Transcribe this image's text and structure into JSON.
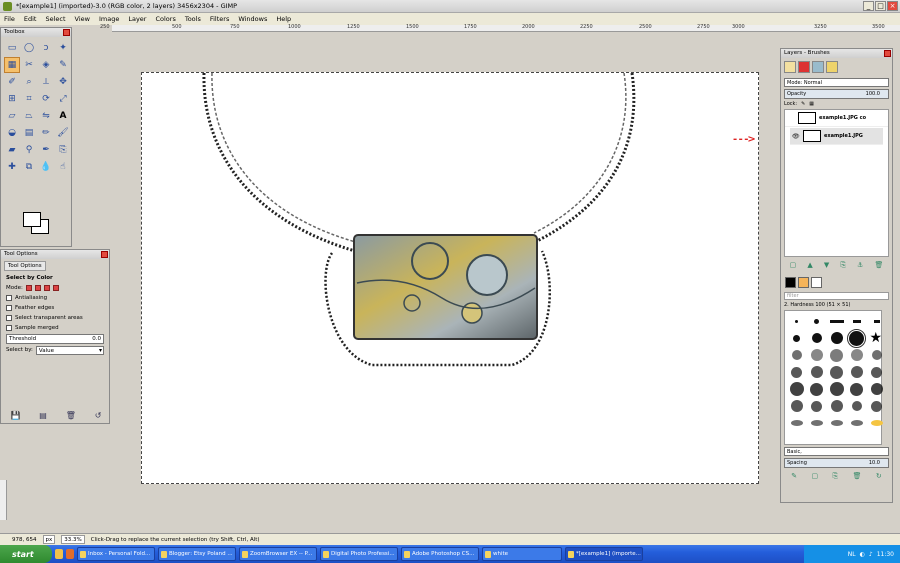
{
  "window": {
    "title": "*[example1] (imported)-3.0 (RGB color, 2 layers) 3456x2304 - GIMP",
    "controls": [
      "_",
      "□",
      "×"
    ]
  },
  "menu": [
    "File",
    "Edit",
    "Select",
    "View",
    "Image",
    "Layer",
    "Colors",
    "Tools",
    "Filters",
    "Windows",
    "Help"
  ],
  "ruler": [
    "250",
    "500",
    "750",
    "1000",
    "1250",
    "1500",
    "1750",
    "2000",
    "2250",
    "2500",
    "2750",
    "3000",
    "3250",
    "3500"
  ],
  "toolbox": {
    "title": "Toolbox",
    "tools": [
      "rect-select",
      "ellipse-select",
      "free-select",
      "fuzzy-select",
      "select-by-color",
      "scissors",
      "foreground-select",
      "paths",
      "color-picker",
      "zoom",
      "measure",
      "move",
      "align",
      "crop",
      "rotate",
      "scale",
      "shear",
      "perspective",
      "flip",
      "text",
      "bucket-fill",
      "blend",
      "pencil",
      "paintbrush",
      "eraser",
      "airbrush",
      "ink",
      "clone",
      "heal",
      "perspective-clone",
      "blur",
      "smudge",
      "dodge-burn"
    ]
  },
  "tool_options": {
    "title": "Tool Options",
    "tab": "Tool Options",
    "heading": "Select by Color",
    "mode_label": "Mode:",
    "antialiasing": "Antialiasing",
    "feather": "Feather edges",
    "transparent": "Select transparent areas",
    "merged": "Sample merged",
    "threshold_label": "Threshold",
    "threshold_value": "0.0",
    "select_by_label": "Select by:",
    "select_by_value": "Value"
  },
  "layers": {
    "title": "Layers - Brushes",
    "mode_label": "Mode:",
    "mode_value": "Normal",
    "opacity_label": "Opacity",
    "opacity_value": "100.0",
    "lock_label": "Lock:",
    "items": [
      {
        "name": "example1.JPG co"
      },
      {
        "name": "example1.JPG"
      }
    ]
  },
  "brushes": {
    "filter_placeholder": "filter",
    "current": "2. Hardness 100 (51 × 51)",
    "preset": "Basic,",
    "spacing_label": "Spacing",
    "spacing_value": "10.0"
  },
  "status": {
    "coords": "978, 654",
    "unit": "px",
    "zoom": "33.3%",
    "message": "Click-Drag to replace the current selection (try Shift, Ctrl, Alt)"
  },
  "taskbar": {
    "start": "start",
    "tasks": [
      "Inbox - Personal Fold...",
      "Blogger: Etsy Poland ...",
      "ZoomBrowser EX -- P...",
      "Digital Photo Professi...",
      "Adobe Photoshop CS...",
      "white",
      "*[example1] (importe..."
    ],
    "lang": "NL",
    "time": "11:30"
  },
  "annotation": {
    "arrow": "- - ->"
  }
}
